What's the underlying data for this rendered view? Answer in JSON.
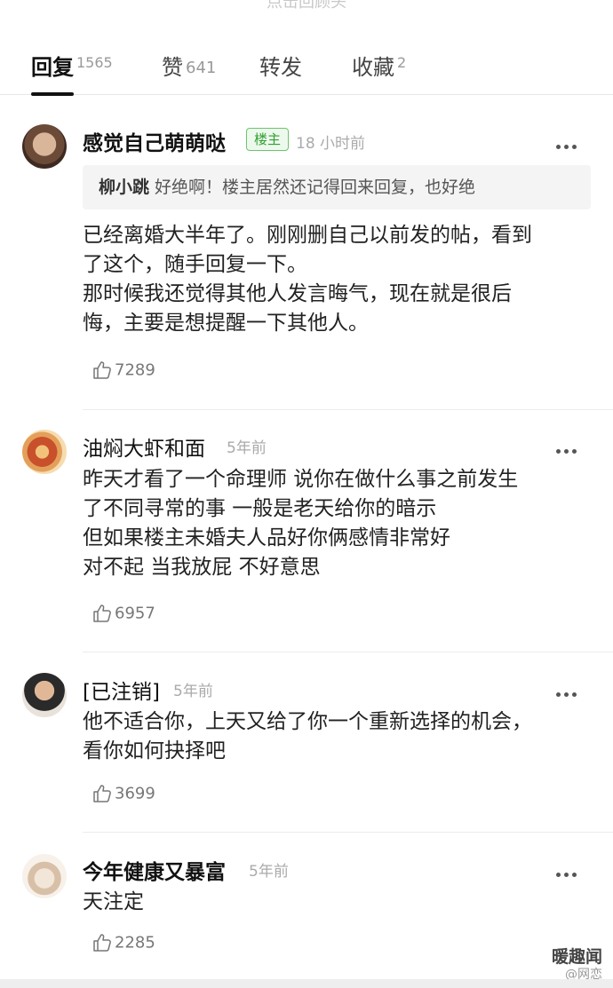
{
  "top_hint": "点击回顾头",
  "tabs": [
    {
      "label": "回复",
      "count": "1565"
    },
    {
      "label": "赞",
      "count": "641"
    },
    {
      "label": "转发",
      "count": ""
    },
    {
      "label": "收藏",
      "count": "2"
    }
  ],
  "comments": [
    {
      "user": "感觉自己萌萌哒",
      "badge": "楼主",
      "time": "18 小时前",
      "quote_user": "柳小跳",
      "quote_text": "好绝啊！楼主居然还记得回来回复，也好绝",
      "lines": [
        "已经离婚大半年了。刚刚删自己以前发的帖，看到",
        "了这个，随手回复一下。",
        "那时候我还觉得其他人发言晦气，现在就是很后",
        "悔，主要是想提醒一下其他人。"
      ],
      "likes": "7289"
    },
    {
      "user": "油焖大虾和面",
      "time": "5年前",
      "lines": [
        "昨天才看了一个命理师 说你在做什么事之前发生",
        "了不同寻常的事 一般是老天给你的暗示",
        "但如果楼主未婚夫人品好你俩感情非常好",
        "对不起 当我放屁 不好意思"
      ],
      "likes": "6957"
    },
    {
      "user": "[已注销]",
      "time": "5年前",
      "lines": [
        "他不适合你，上天又给了你一个重新选择的机会，",
        "看你如何抉择吧"
      ],
      "likes": "3699"
    },
    {
      "user": "今年健康又暴富",
      "time": "5年前",
      "lines": [
        "天注定"
      ],
      "likes": "2285"
    }
  ],
  "watermark": {
    "line1": "暖趣闻",
    "line2": "@网恋"
  }
}
